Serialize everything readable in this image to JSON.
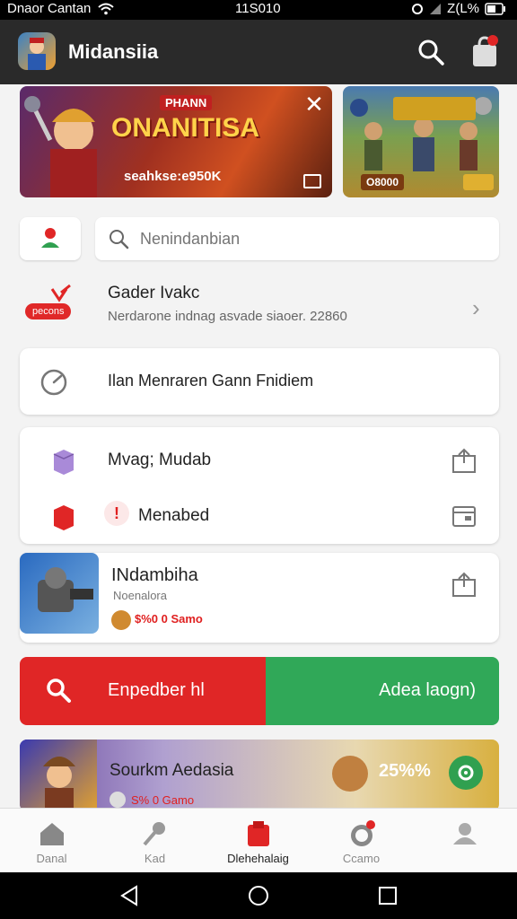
{
  "status_bar": {
    "carrier": "Dnaor Cantan",
    "time": "11S010",
    "battery": "Z(L%"
  },
  "app_bar": {
    "title": "Midansiia"
  },
  "banners": {
    "main": {
      "tag": "PHANN",
      "title": "ONANITISA",
      "subtitle": "seahkse:e950K"
    },
    "side": {
      "price": "O8000"
    }
  },
  "search": {
    "placeholder": "Nenindanbian"
  },
  "notice": {
    "badge": "pecons",
    "title": "Gader Ivakc",
    "text": "Nerdarone indnag asvade siaoer. 22860"
  },
  "card_main": {
    "label": "Ilan Menraren Gann Fnidiem"
  },
  "list_rows": [
    {
      "label": "Mvag; Mudab"
    },
    {
      "label": "Menabed",
      "alert": "!"
    }
  ],
  "game_card": {
    "title": "INdambiha",
    "subtitle": "Noenalora",
    "price": "$%0 0 Samo"
  },
  "split_button": {
    "left_label": "Enpedber hl",
    "right_label": "Adea laogn)"
  },
  "promo": {
    "title": "Sourkm Aedasia",
    "price": "S% 0 Gamo",
    "percent": "25%%"
  },
  "bottom_nav": [
    {
      "label": "Danal",
      "icon": "home-icon"
    },
    {
      "label": "Kad",
      "icon": "tools-icon"
    },
    {
      "label": "Dlehehalaig",
      "icon": "store-icon",
      "active": true
    },
    {
      "label": "Ccamo",
      "icon": "notification-icon"
    },
    {
      "label": "",
      "icon": "profile-icon"
    }
  ],
  "colors": {
    "accent_red": "#e02626",
    "accent_green": "#30a858",
    "app_bar": "#2a2a2a"
  }
}
